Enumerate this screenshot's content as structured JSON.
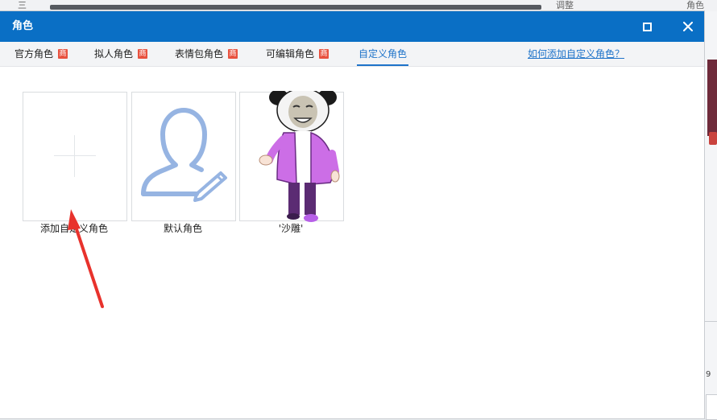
{
  "background": {
    "top_left_glyph": "三",
    "top_right_text": "调整",
    "top_far_right_text": "角色",
    "right_number": "9"
  },
  "dialog": {
    "title": "角色",
    "maximize_icon": "maximize-icon",
    "close_icon": "close-icon",
    "close_glyph": "✕"
  },
  "tabs": [
    {
      "label": "官方角色",
      "badge": "商",
      "active": false
    },
    {
      "label": "拟人角色",
      "badge": "商",
      "active": false
    },
    {
      "label": "表情包角色",
      "badge": "商",
      "active": false
    },
    {
      "label": "可编辑角色",
      "badge": "商",
      "active": false
    },
    {
      "label": "自定义角色",
      "badge": "",
      "active": true
    }
  ],
  "help_link": "如何添加自定义角色？",
  "characters": [
    {
      "label": "添加自定义角色",
      "icon": "plus-icon"
    },
    {
      "label": "默认角色",
      "icon": "user-edit-icon"
    },
    {
      "label": "'沙雕'",
      "icon": "panda-meme-figure"
    }
  ],
  "colors": {
    "titlebar": "#0a6fc5",
    "accent": "#1e73c9",
    "badge": "#e8523f",
    "annotation_arrow": "#e8322c"
  }
}
